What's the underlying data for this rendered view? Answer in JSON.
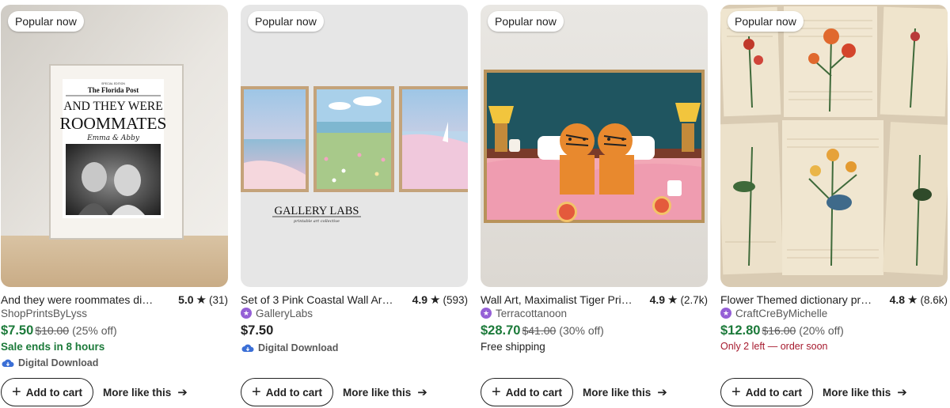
{
  "cards": [
    {
      "badge": "Popular now",
      "title": "And they were roommates di…",
      "rating": "5.0",
      "reviews": "(31)",
      "shop": "ShopPrintsByLyss",
      "star_seller": false,
      "price": "$7.50",
      "original_price": "$10.00",
      "discount": "(25% off)",
      "line3": "Sale ends in 8 hours",
      "digital": "Digital Download",
      "add_to_cart": "Add to cart",
      "more_like_this": "More like this",
      "image": {
        "paper_top": "SPECIAL EDITION",
        "masthead": "The Florida Post",
        "headline1": "AND THEY WERE",
        "headline2": "ROOMMATES",
        "names": "Emma & Abby"
      }
    },
    {
      "badge": "Popular now",
      "title": "Set of 3 Pink Coastal Wall Art…",
      "rating": "4.9",
      "reviews": "(593)",
      "shop": "GalleryLabs",
      "star_seller": true,
      "price": "$7.50",
      "original_price": "",
      "discount": "",
      "line3": "",
      "digital": "Digital Download",
      "add_to_cart": "Add to cart",
      "more_like_this": "More like this",
      "image": {
        "brand": "GALLERY LABS",
        "tagline": "printable art collective"
      }
    },
    {
      "badge": "Popular now",
      "title": "Wall Art, Maximalist Tiger Pri…",
      "rating": "4.9",
      "reviews": "(2.7k)",
      "shop": "Terracottanoon",
      "star_seller": true,
      "price": "$28.70",
      "original_price": "$41.00",
      "discount": "(30% off)",
      "line3": "Free shipping",
      "digital": "",
      "add_to_cart": "Add to cart",
      "more_like_this": "More like this"
    },
    {
      "badge": "Popular now",
      "title": "Flower Themed dictionary pr…",
      "rating": "4.8",
      "reviews": "(8.6k)",
      "shop": "CraftCreByMichelle",
      "star_seller": true,
      "price": "$12.80",
      "original_price": "$16.00",
      "discount": "(20% off)",
      "line3": "Only 2 left — order soon",
      "digital": "",
      "add_to_cart": "Add to cart",
      "more_like_this": "More like this"
    }
  ],
  "colors": {
    "sale_price": "#1c7a3a",
    "urgency": "#a61a2e",
    "star_seller": "#9560d6",
    "digital_cloud": "#3b6fd6",
    "text_primary": "#222222",
    "text_secondary": "#595959"
  },
  "icons": {
    "star": "star-icon",
    "star_seller": "star-seller-icon",
    "cloud": "cloud-download-icon",
    "plus": "plus-icon",
    "arrow": "arrow-right-icon"
  }
}
